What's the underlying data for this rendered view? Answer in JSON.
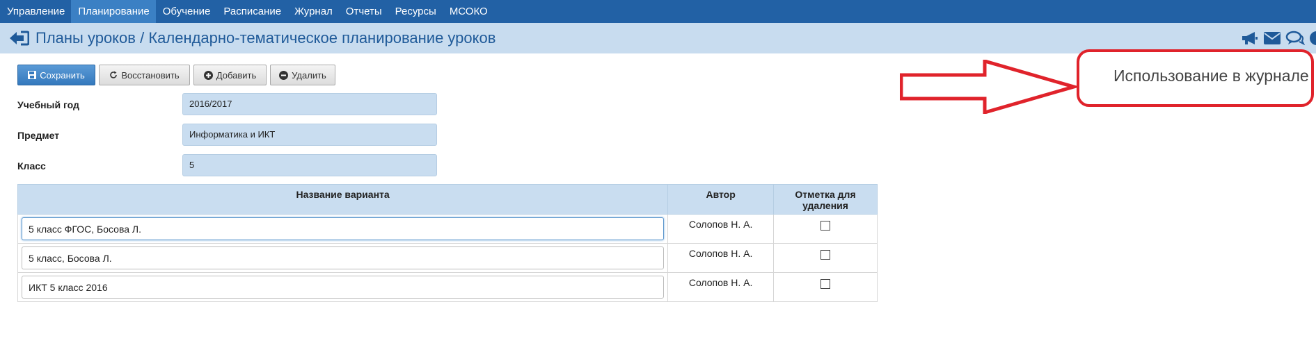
{
  "nav": {
    "items": [
      {
        "label": "Управление",
        "active": false
      },
      {
        "label": "Планирование",
        "active": true
      },
      {
        "label": "Обучение",
        "active": false
      },
      {
        "label": "Расписание",
        "active": false
      },
      {
        "label": "Журнал",
        "active": false
      },
      {
        "label": "Отчеты",
        "active": false
      },
      {
        "label": "Ресурсы",
        "active": false
      },
      {
        "label": "МСОКО",
        "active": false
      }
    ]
  },
  "header": {
    "title": "Планы уроков / Календарно-тематическое планирование уроков",
    "icons": [
      "megaphone-icon",
      "envelope-icon",
      "chat-icon",
      "help-icon"
    ]
  },
  "toolbar": {
    "save_label": "Сохранить",
    "restore_label": "Восстановить",
    "add_label": "Добавить",
    "delete_label": "Удалить"
  },
  "form": {
    "year_label": "Учебный год",
    "year_value": "2016/2017",
    "subject_label": "Предмет",
    "subject_value": "Информатика и ИКТ",
    "class_label": "Класс",
    "class_value": "5"
  },
  "table": {
    "headers": {
      "name": "Название варианта",
      "author": "Автор",
      "mark": "Отметка для удаления"
    },
    "rows": [
      {
        "name": "5 класс ФГОС, Босова Л.",
        "author": "Солопов Н. А.",
        "checked": false
      },
      {
        "name": "5 класс, Босова Л.",
        "author": "Солопов Н. А.",
        "checked": false
      },
      {
        "name": "ИКТ 5 класс 2016",
        "author": "Солопов Н. А.",
        "checked": false
      }
    ]
  },
  "annotation": {
    "callout_text": "Использование в журнале",
    "color": "#e0232b"
  }
}
